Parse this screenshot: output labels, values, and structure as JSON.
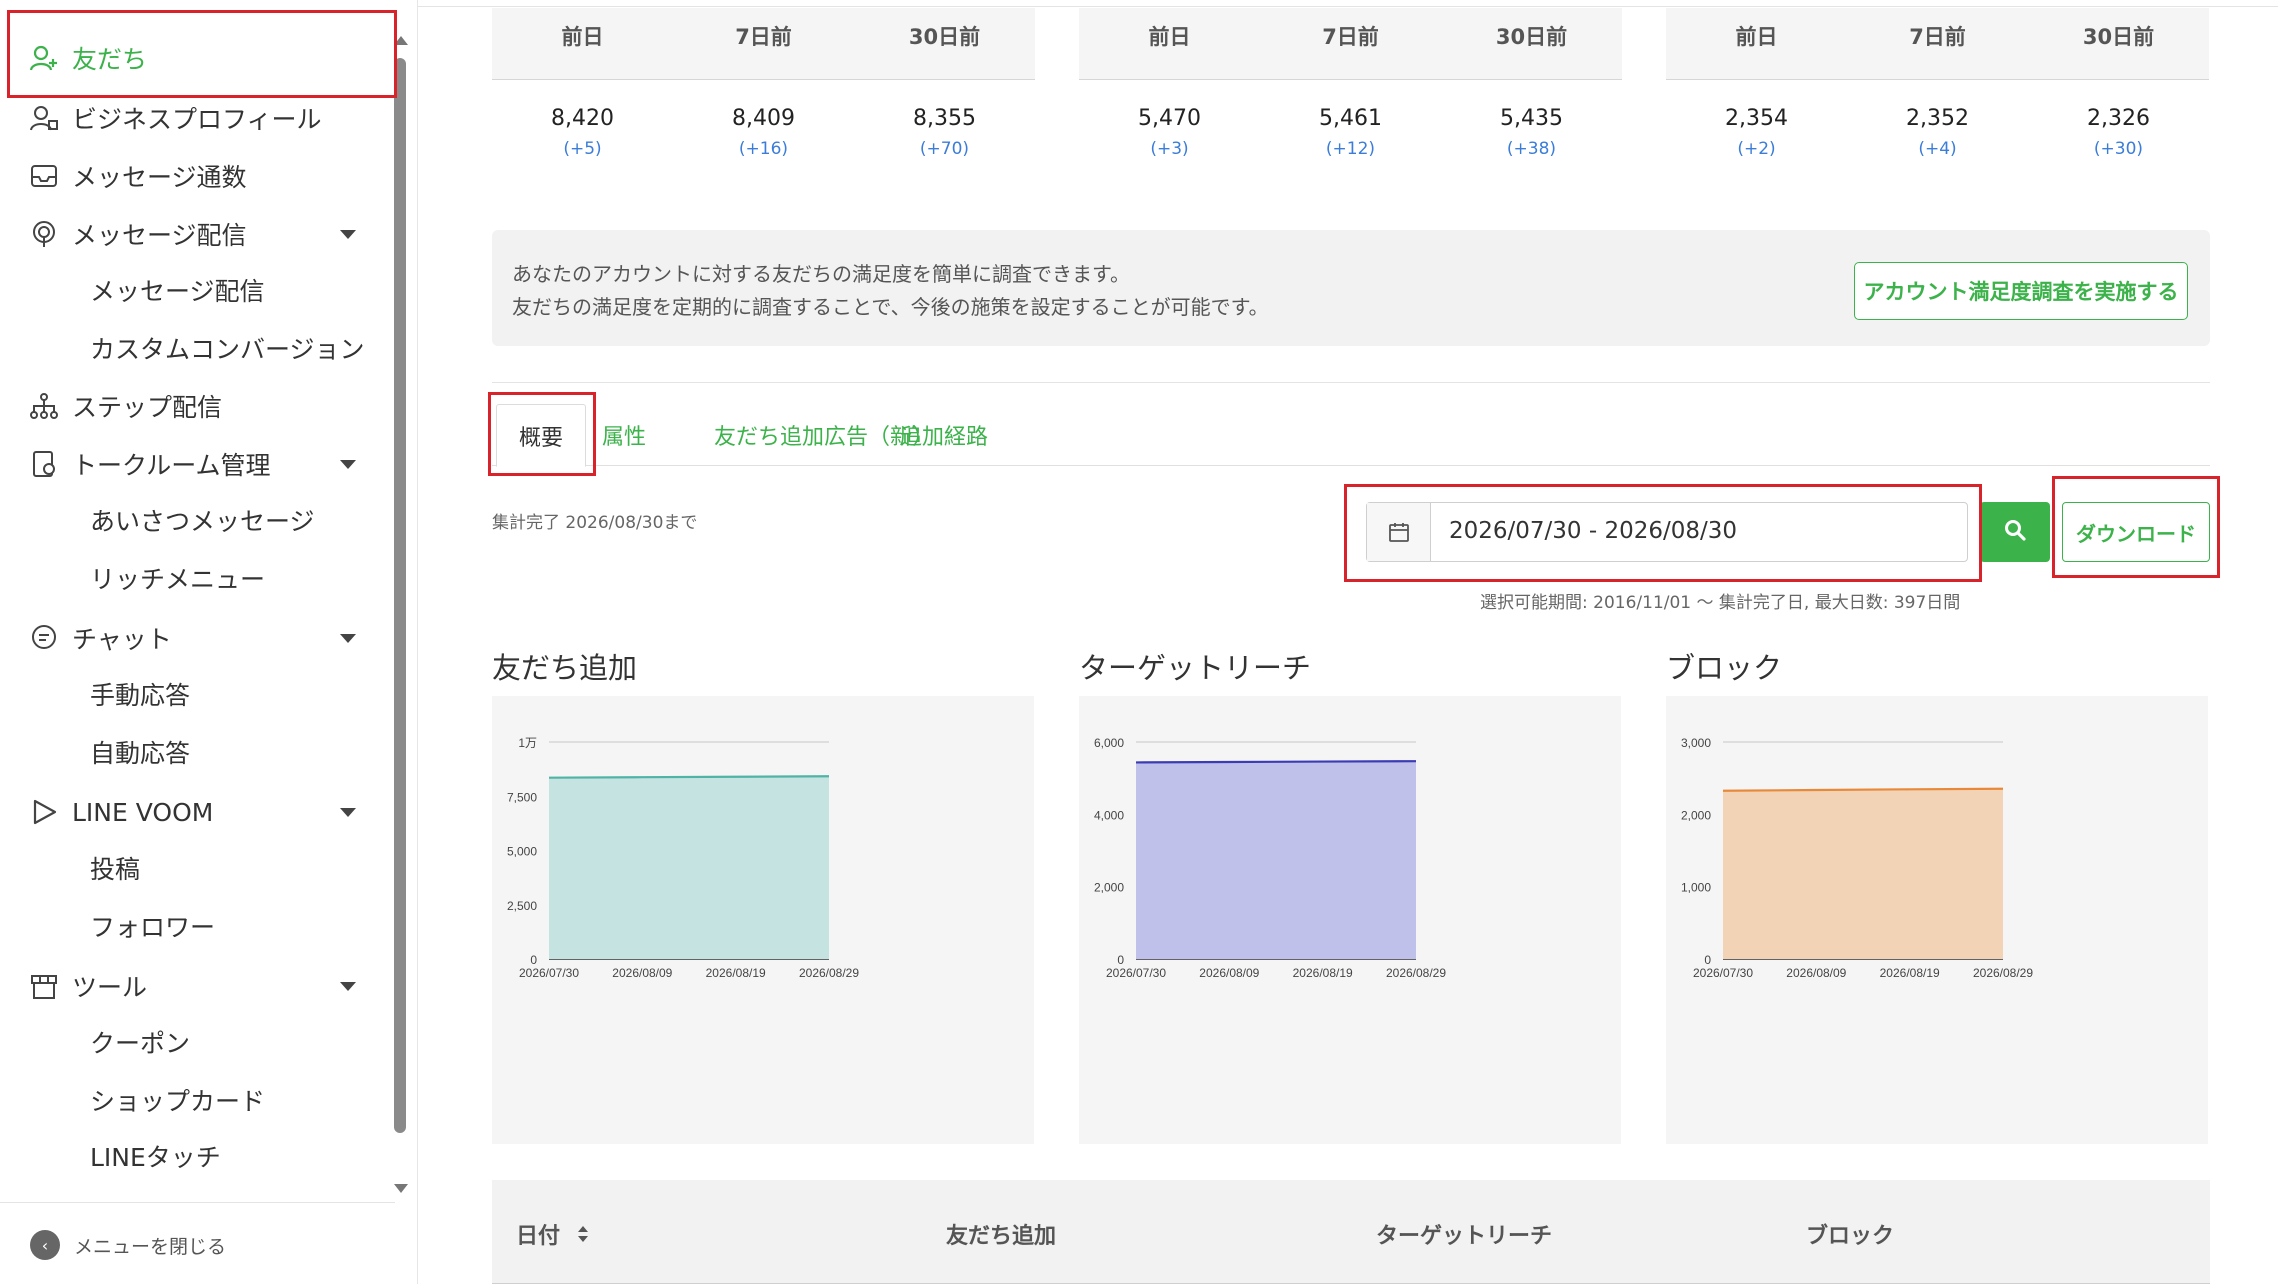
{
  "sidebar": {
    "items": [
      {
        "label": "友だち",
        "icon": "add-friend-icon"
      },
      {
        "label": "ビジネスプロフィール",
        "icon": "profile-icon"
      },
      {
        "label": "メッセージ通数",
        "icon": "inbox-icon"
      },
      {
        "label": "メッセージ配信",
        "icon": "broadcast-icon"
      },
      {
        "label": "ステップ配信",
        "icon": "step-icon"
      },
      {
        "label": "トークルーム管理",
        "icon": "talkroom-icon"
      },
      {
        "label": "チャット",
        "icon": "chat-icon"
      },
      {
        "label": "LINE VOOM",
        "icon": "voom-icon"
      },
      {
        "label": "ツール",
        "icon": "tool-icon"
      }
    ],
    "subitems": {
      "message": [
        "メッセージ配信",
        "カスタムコンバージョン"
      ],
      "talkroom": [
        "あいさつメッセージ",
        "リッチメニュー"
      ],
      "chat": [
        "手動応答",
        "自動応答"
      ],
      "voom": [
        "投稿",
        "フォロワー"
      ],
      "tool": [
        "クーポン",
        "ショップカード",
        "LINEタッチ"
      ]
    },
    "close_menu": "メニューを閉じる"
  },
  "stats": [
    {
      "headers": [
        "前日",
        "7日前",
        "30日前"
      ],
      "values": [
        "8,420",
        "8,409",
        "8,355"
      ],
      "deltas": [
        "(+5)",
        "(+16)",
        "(+70)"
      ]
    },
    {
      "headers": [
        "前日",
        "7日前",
        "30日前"
      ],
      "values": [
        "5,470",
        "5,461",
        "5,435"
      ],
      "deltas": [
        "(+3)",
        "(+12)",
        "(+38)"
      ]
    },
    {
      "headers": [
        "前日",
        "7日前",
        "30日前"
      ],
      "values": [
        "2,354",
        "2,352",
        "2,326"
      ],
      "deltas": [
        "(+2)",
        "(+4)",
        "(+30)"
      ]
    }
  ],
  "survey": {
    "line1": "あなたのアカウントに対する友だちの満足度を簡単に調査できます。",
    "line2": "友だちの満足度を定期的に調査することで、今後の施策を設定することが可能です。",
    "button": "アカウント満足度調査を実施する"
  },
  "tabs": [
    "概要",
    "属性",
    "友だち追加広告（新）",
    "追加経路"
  ],
  "aggregation_note": "集計完了 2026/08/30まで",
  "date_range": "2026/07/30 - 2026/08/30",
  "download_label": "ダウンロード",
  "period_note": "選択可能期間: 2016/11/01 ～ 集計完了日, 最大日数: 397日間",
  "table_headers": [
    "日付",
    "友だち追加",
    "ターゲットリーチ",
    "ブロック"
  ],
  "colors": {
    "accent": "#3cb24a",
    "highlight": "#d9232b"
  },
  "chart_data": [
    {
      "type": "area",
      "title": "友だち追加",
      "x": [
        "2026/07/30",
        "2026/08/09",
        "2026/08/19",
        "2026/08/29"
      ],
      "values": [
        8355,
        8378,
        8400,
        8420
      ],
      "ylim": [
        0,
        10000
      ],
      "yticks": [
        "0",
        "2,500",
        "5,000",
        "7,500",
        "1万"
      ],
      "ytick_values": [
        0,
        2500,
        5000,
        7500,
        10000
      ],
      "line_color": "#4fb3a6",
      "fill_color": "#c5e3e1"
    },
    {
      "type": "area",
      "title": "ターゲットリーチ",
      "x": [
        "2026/07/30",
        "2026/08/09",
        "2026/08/19",
        "2026/08/29"
      ],
      "values": [
        5435,
        5447,
        5459,
        5470
      ],
      "ylim": [
        0,
        6000
      ],
      "yticks": [
        "0",
        "2,000",
        "4,000",
        "6,000"
      ],
      "ytick_values": [
        0,
        2000,
        4000,
        6000
      ],
      "line_color": "#3b3bb5",
      "fill_color": "#c0c1ea"
    },
    {
      "type": "area",
      "title": "ブロック",
      "x": [
        "2026/07/30",
        "2026/08/09",
        "2026/08/19",
        "2026/08/29"
      ],
      "values": [
        2326,
        2336,
        2346,
        2354
      ],
      "ylim": [
        0,
        3000
      ],
      "yticks": [
        "0",
        "1,000",
        "2,000",
        "3,000"
      ],
      "ytick_values": [
        0,
        1000,
        2000,
        3000
      ],
      "line_color": "#e8893a",
      "fill_color": "#f3d3b5"
    }
  ]
}
